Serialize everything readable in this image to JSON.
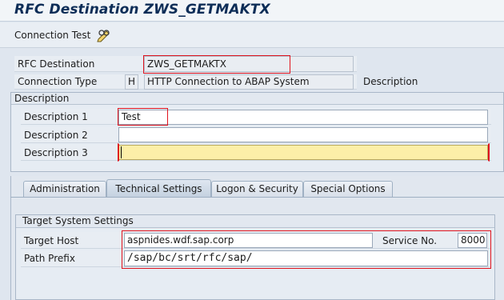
{
  "window": {
    "title": "RFC Destination ZWS_GETMAKTX"
  },
  "toolbar": {
    "connection_test_label": "Connection Test",
    "edit_icon": "pencil-glasses-icon"
  },
  "header_fields": {
    "rfc_destination_label": "RFC Destination",
    "rfc_destination_value": "ZWS_GETMAKTX",
    "connection_type_label": "Connection Type",
    "connection_type_code": "H",
    "connection_type_text": "HTTP Connection to ABAP System",
    "description_link": "Description"
  },
  "description_group": {
    "title": "Description",
    "desc1_label": "Description 1",
    "desc1_value": "Test",
    "desc2_label": "Description 2",
    "desc2_value": "",
    "desc3_label": "Description 3",
    "desc3_value": ""
  },
  "tabs": [
    {
      "label": "Administration"
    },
    {
      "label": "Technical Settings"
    },
    {
      "label": "Logon & Security"
    },
    {
      "label": "Special Options"
    }
  ],
  "target_system": {
    "title": "Target System Settings",
    "target_host_label": "Target Host",
    "target_host_value": "aspnides.wdf.sap.corp",
    "service_no_label": "Service No.",
    "service_no_value": "8000",
    "path_prefix_label": "Path Prefix",
    "path_prefix_value": "/sap/bc/srt/rfc/sap/"
  },
  "colors": {
    "highlight_border": "#e0141e",
    "active_field": "#fcefa8",
    "title_text": "#0d2d57"
  }
}
